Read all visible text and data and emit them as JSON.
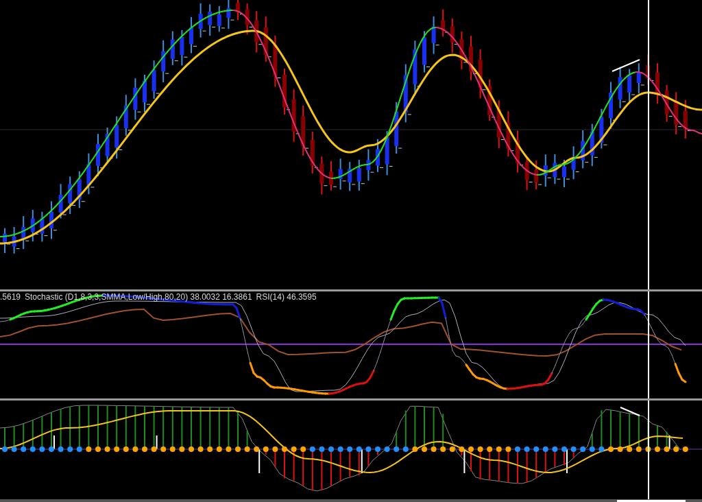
{
  "indicator_legend": [
    {
      "text": ".5619"
    },
    {
      "text": "Stochastic (D1,8,3,3,SMMA,Low/High,80,20) 38.0032 16.3861"
    },
    {
      "text": "RSI(14) 46.3595"
    }
  ]
}
